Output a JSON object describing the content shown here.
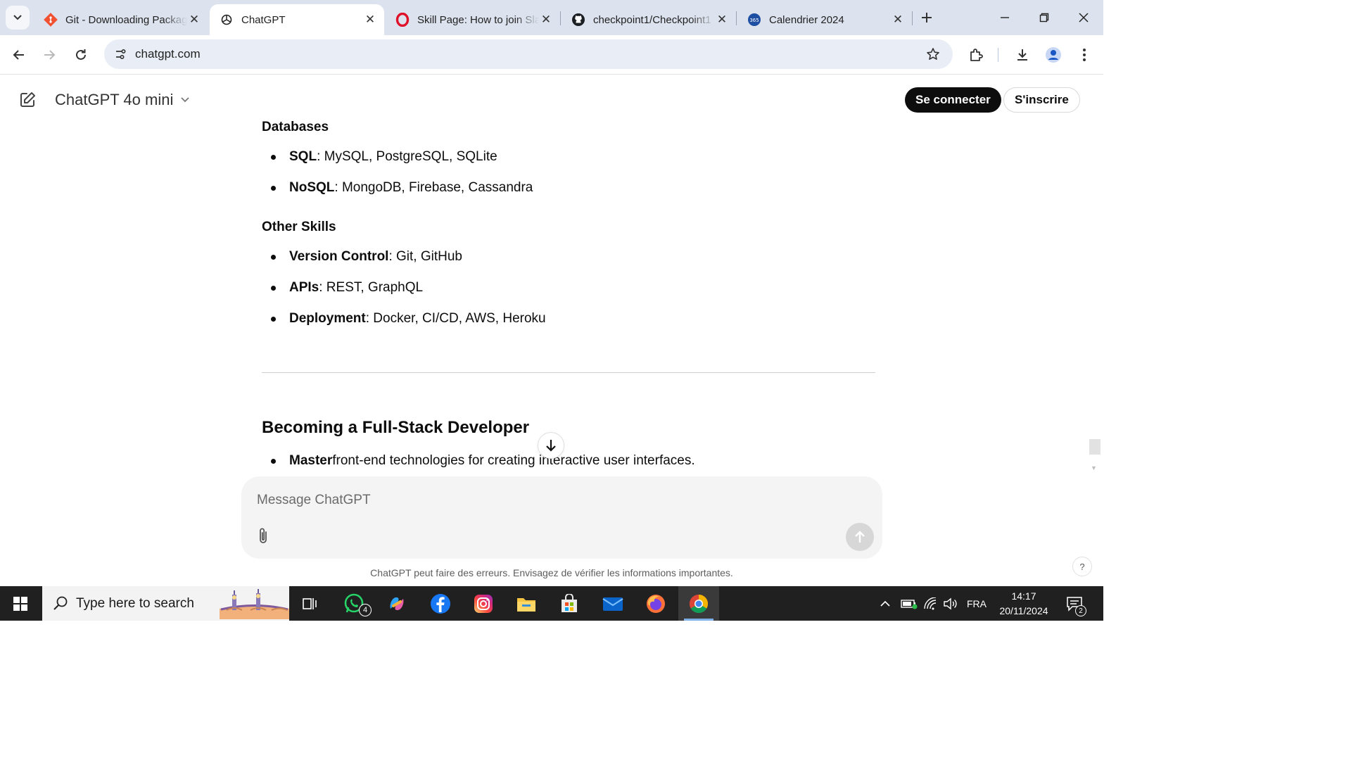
{
  "browser": {
    "tabs": [
      {
        "title": "Git - Downloading Package",
        "icon": "git-icon",
        "active": false
      },
      {
        "title": "ChatGPT",
        "icon": "openai-icon",
        "active": true
      },
      {
        "title": "Skill Page: How to join Slack",
        "icon": "opera-icon",
        "active": false
      },
      {
        "title": "checkpoint1/Checkpoint1",
        "icon": "github-icon",
        "active": false
      },
      {
        "title": "Calendrier 2024",
        "icon": "calendar-365-icon",
        "active": false
      }
    ],
    "url": "chatgpt.com"
  },
  "header": {
    "model_name": "ChatGPT 4o mini",
    "login_label": "Se connecter",
    "signup_label": "S'inscrire"
  },
  "content": {
    "sections": [
      {
        "heading": "Databases",
        "items": [
          {
            "term": "SQL",
            "rest": ": MySQL, PostgreSQL, SQLite"
          },
          {
            "term": "NoSQL",
            "rest": ": MongoDB, Firebase, Cassandra"
          }
        ]
      },
      {
        "heading": "Other Skills",
        "items": [
          {
            "term": "Version Control",
            "rest": ": Git, GitHub"
          },
          {
            "term": "APIs",
            "rest": ": REST, GraphQL"
          },
          {
            "term": "Deployment",
            "rest": ": Docker, CI/CD, AWS, Heroku"
          }
        ]
      }
    ],
    "h2": "Becoming a Full-Stack Developer",
    "h2_items": [
      {
        "term": "Master",
        "rest": " front-end technologies for creating interactive user interfaces."
      }
    ]
  },
  "composer": {
    "placeholder": "Message ChatGPT",
    "disclaimer": "ChatGPT peut faire des erreurs. Envisagez de vérifier les informations importantes.",
    "help_label": "?"
  },
  "taskbar": {
    "search_placeholder": "Type here to search",
    "whatsapp_badge": "4",
    "language": "FRA",
    "time": "14:17",
    "date": "20/11/2024",
    "notification_count": "2"
  },
  "colors": {
    "accent_dark": "#0d0d0d",
    "tabstrip": "#dde3ee",
    "omnibox": "#e9eef6",
    "taskbar": "#202020"
  }
}
